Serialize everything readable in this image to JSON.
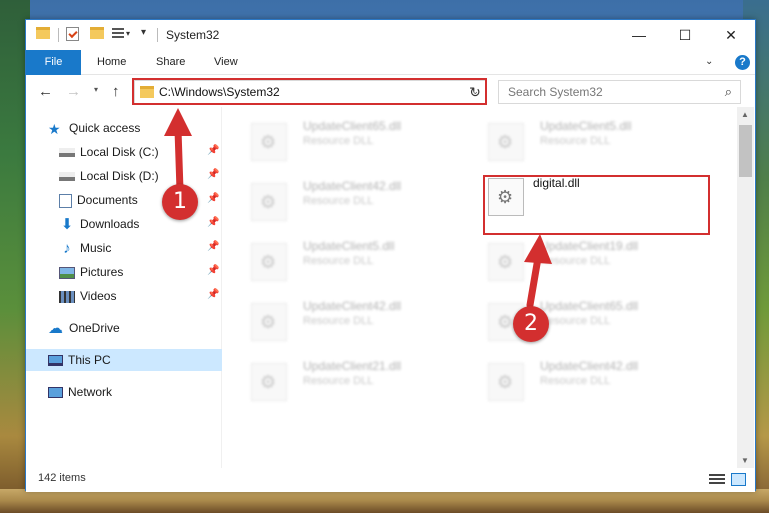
{
  "window": {
    "title": "System32",
    "controls": {
      "minimize": "—",
      "maximize": "☐",
      "close": "✕"
    }
  },
  "ribbon": {
    "tabs": [
      "File",
      "Home",
      "Share",
      "View"
    ],
    "help": "?"
  },
  "address_bar": {
    "path": "C:\\Windows\\System32",
    "refresh": "↻"
  },
  "search": {
    "placeholder": "Search System32"
  },
  "sidebar": {
    "quick_access": "Quick access",
    "items": [
      {
        "label": "Local Disk (C:)",
        "icon": "drive-icon",
        "pinned": true
      },
      {
        "label": "Local Disk (D:)",
        "icon": "drive-icon",
        "pinned": true
      },
      {
        "label": "Documents",
        "icon": "documents-icon",
        "pinned": true
      },
      {
        "label": "Downloads",
        "icon": "download-icon",
        "pinned": true
      },
      {
        "label": "Music",
        "icon": "music-icon",
        "pinned": true
      },
      {
        "label": "Pictures",
        "icon": "pictures-icon",
        "pinned": true
      },
      {
        "label": "Videos",
        "icon": "videos-icon",
        "pinned": true
      }
    ],
    "onedrive": "OneDrive",
    "this_pc": "This PC",
    "network": "Network"
  },
  "files": [
    {
      "name": "UpdateClient65.dll",
      "type": "Resource DLL"
    },
    {
      "name": "UpdateClient5.dll",
      "type": "Resource DLL"
    },
    {
      "name": "UpdateClient42.dll",
      "type": "Resource DLL"
    },
    {
      "name": "digital.dll",
      "type": ""
    },
    {
      "name": "UpdateClient5.dll",
      "type": "Resource DLL"
    },
    {
      "name": "UpdateClient19.dll",
      "type": "Resource DLL"
    },
    {
      "name": "UpdateClient42.dll",
      "type": "Resource DLL"
    },
    {
      "name": "UpdateClient65.dll",
      "type": "Resource DLL"
    },
    {
      "name": "UpdateClient21.dll",
      "type": "Resource DLL"
    },
    {
      "name": "UpdateClient42.dll",
      "type": "Resource DLL"
    }
  ],
  "status": {
    "item_count": "142 items"
  },
  "annotations": {
    "step1": "1",
    "step2": "2",
    "color": "#d32f2f"
  },
  "colors": {
    "accent": "#1979ca",
    "selection": "#cce8ff",
    "annotation": "#d32f2f"
  }
}
